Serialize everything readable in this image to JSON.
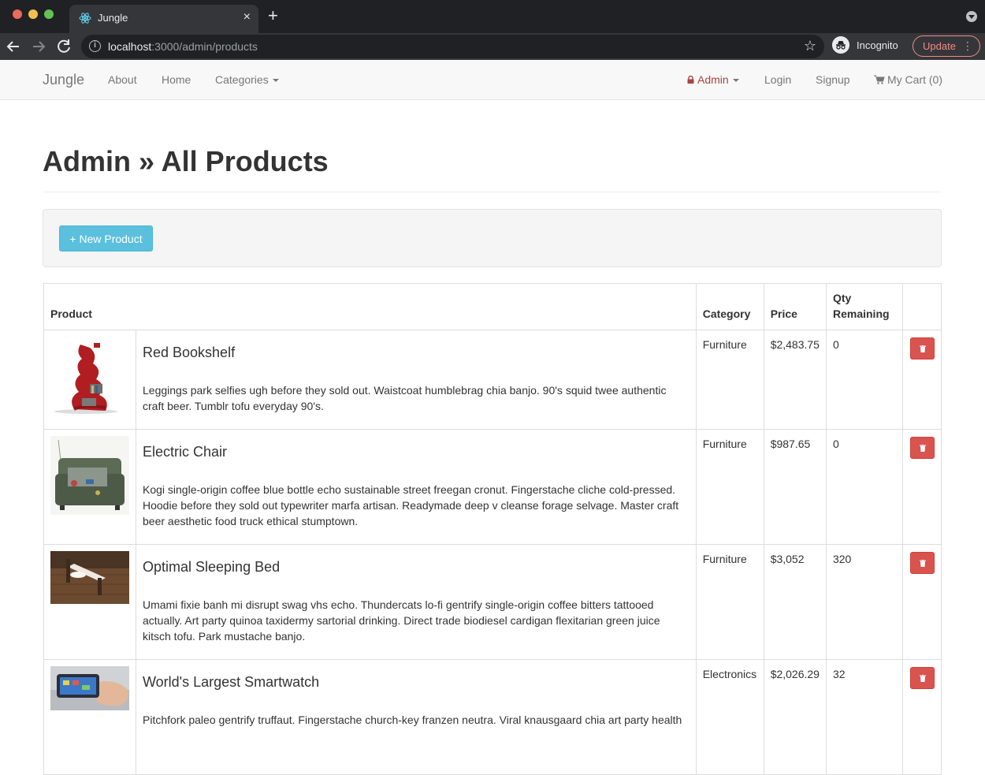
{
  "browser": {
    "tab_title": "Jungle",
    "tab_close": "×",
    "new_tab": "+",
    "url_host": "localhost",
    "url_path": ":3000/admin/products",
    "profile_label": "Incognito",
    "update_label": "Update",
    "update_dots": "⋮",
    "back_icon": "back-arrow-icon",
    "forward_icon": "forward-arrow-icon",
    "reload_icon": "reload-icon",
    "bookmark_icon": "star-icon"
  },
  "navbar": {
    "brand": "Jungle",
    "links": {
      "about": "About",
      "home": "Home",
      "categories": "Categories"
    },
    "admin": "Admin",
    "login": "Login",
    "signup": "Signup",
    "cart": "My Cart (0)"
  },
  "page": {
    "title": "Admin » All Products",
    "new_product_label": "+ New Product"
  },
  "table": {
    "headers": {
      "product": "Product",
      "category": "Category",
      "price": "Price",
      "qty_line1": "Qty",
      "qty_line2": "Remaining"
    },
    "rows": [
      {
        "name": "Red Bookshelf",
        "description": "Leggings park selfies ugh before they sold out. Waistcoat humblebrag chia banjo. 90's squid twee authentic craft beer. Tumblr tofu everyday 90's.",
        "category": "Furniture",
        "price": "$2,483.75",
        "qty": "0"
      },
      {
        "name": "Electric Chair",
        "description": "Kogi single-origin coffee blue bottle echo sustainable street freegan cronut. Fingerstache cliche cold-pressed. Hoodie before they sold out typewriter marfa artisan. Readymade deep v cleanse forage selvage. Master craft beer aesthetic food truck ethical stumptown.",
        "category": "Furniture",
        "price": "$987.65",
        "qty": "0"
      },
      {
        "name": "Optimal Sleeping Bed",
        "description": "Umami fixie banh mi disrupt swag vhs echo. Thundercats lo-fi gentrify single-origin coffee bitters tattooed actually. Art party quinoa taxidermy sartorial drinking. Direct trade biodiesel cardigan flexitarian green juice kitsch tofu. Park mustache banjo.",
        "category": "Furniture",
        "price": "$3,052",
        "qty": "320"
      },
      {
        "name": "World's Largest Smartwatch",
        "description": "Pitchfork paleo gentrify truffaut. Fingerstache church-key franzen neutra. Viral knausgaard chia art party health",
        "category": "Electronics",
        "price": "$2,026.29",
        "qty": "32"
      }
    ]
  },
  "colors": {
    "danger": "#d9534f",
    "info": "#5bc0de",
    "admin_link": "#a94442"
  }
}
